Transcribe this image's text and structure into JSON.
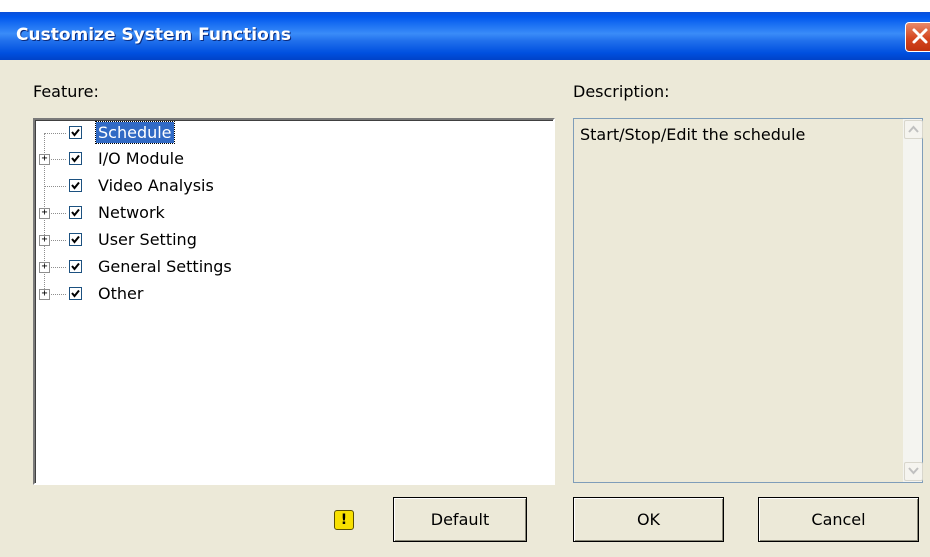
{
  "window": {
    "title": "Customize System Functions"
  },
  "feature": {
    "label": "Feature:",
    "tree": [
      {
        "label": "Schedule",
        "checked": true,
        "expandable": false,
        "selected": true
      },
      {
        "label": "I/O Module",
        "checked": true,
        "expandable": true,
        "selected": false
      },
      {
        "label": "Video Analysis",
        "checked": true,
        "expandable": false,
        "selected": false
      },
      {
        "label": "Network",
        "checked": true,
        "expandable": true,
        "selected": false
      },
      {
        "label": "User Setting",
        "checked": true,
        "expandable": true,
        "selected": false
      },
      {
        "label": "General Settings",
        "checked": true,
        "expandable": true,
        "selected": false
      },
      {
        "label": "Other",
        "checked": true,
        "expandable": true,
        "selected": false
      }
    ]
  },
  "description": {
    "label": "Description:",
    "text": "Start/Stop/Edit the schedule"
  },
  "buttons": {
    "default": "Default",
    "ok": "OK",
    "cancel": "Cancel"
  },
  "icons": {
    "close": "close-icon",
    "warning": "warning-icon",
    "expander": "plus-icon",
    "checkbox": "checkmark-icon"
  },
  "colors": {
    "title_bar": "#0058ee",
    "selection": "#316ac5",
    "dialog_bg": "#ece9d8",
    "close_button": "#d5461f",
    "warning": "#f8e000"
  }
}
